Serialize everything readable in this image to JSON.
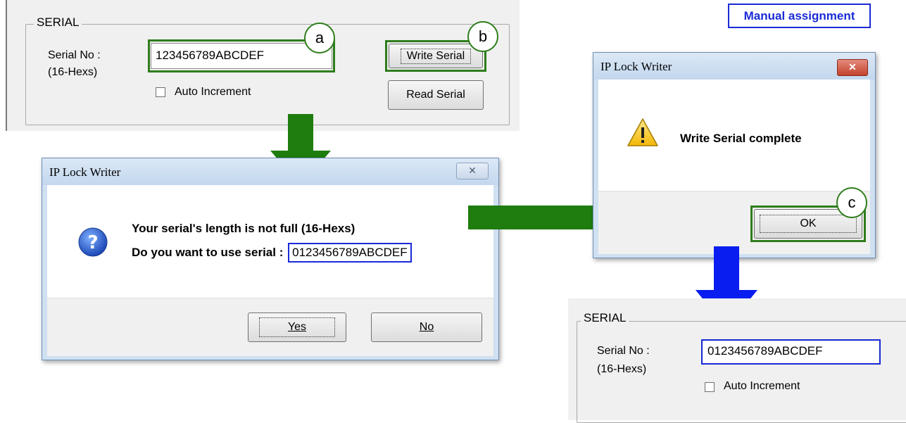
{
  "annotations": {
    "manual_tag": "Manual assignment",
    "marker_a": "a",
    "marker_b": "b",
    "marker_c": "c"
  },
  "serial_panel_top": {
    "group_title": "SERIAL",
    "serial_label": "Serial No :",
    "hex_hint": "(16-Hexs)",
    "serial_value": "123456789ABCDEF",
    "auto_increment_label": "Auto Increment",
    "write_button": "Write Serial",
    "read_button": "Read Serial"
  },
  "confirm_dialog": {
    "title": "IP Lock Writer",
    "message_line1": "Your serial's length is not full (16-Hexs)",
    "message_line2_prefix": "Do you want to use serial :",
    "message_serial": "0123456789ABCDEF",
    "yes_button": "Yes",
    "no_button": "No"
  },
  "complete_dialog": {
    "title": "IP Lock Writer",
    "message": "Write Serial complete",
    "ok_button": "OK"
  },
  "serial_panel_bottom": {
    "group_title": "SERIAL",
    "serial_label": "Serial No :",
    "hex_hint": "(16-Hexs)",
    "serial_value": "0123456789ABCDEF",
    "auto_increment_label": "Auto Increment"
  },
  "colors": {
    "green_arrow": "#1e7d0e",
    "blue_arrow": "#0a1df0",
    "highlight_green": "#2e7d1b",
    "highlight_blue": "#1a2bd6"
  },
  "icons": {
    "question": "question-icon",
    "warning": "warning-icon",
    "close": "close-icon"
  }
}
